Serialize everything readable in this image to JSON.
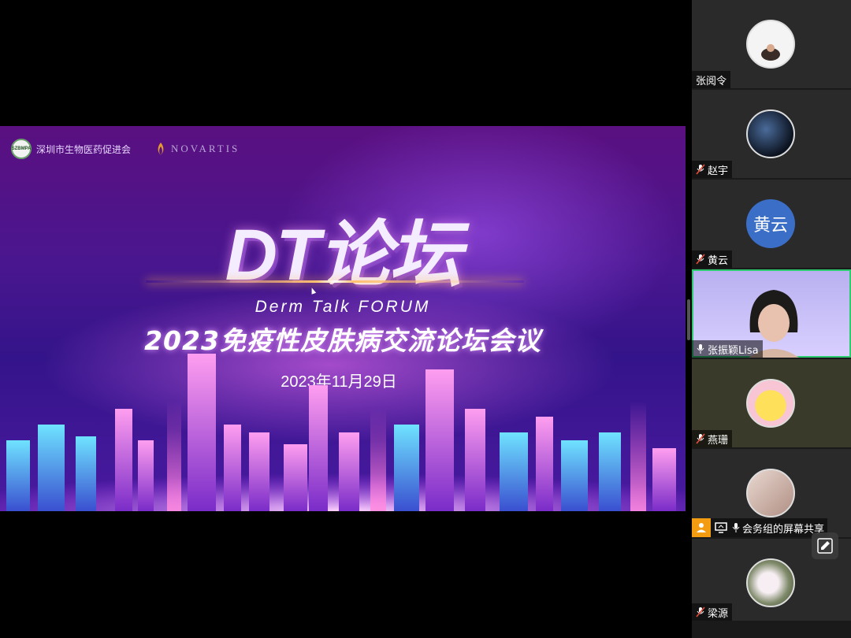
{
  "slide": {
    "org_seal": "SZBMPA",
    "org_name": "深圳市生物医药促进会",
    "sponsor": "NOVARTIS",
    "main_title": "DT论坛",
    "subtitle_en": "Derm Talk FORUM",
    "subtitle_cn": "2023免疫性皮肤病交流论坛会议",
    "date": "2023年11月29日"
  },
  "participants": [
    {
      "name": "张阅令",
      "muted": false,
      "avatar": "photo",
      "active": false
    },
    {
      "name": "赵宇",
      "muted": true,
      "avatar": "photo",
      "active": false
    },
    {
      "name": "黄云",
      "muted": true,
      "avatar_text": "黄云",
      "active": false
    },
    {
      "name": "张振颖Lisa",
      "muted": false,
      "avatar": "video",
      "active": true
    },
    {
      "name": "燕珊",
      "muted": true,
      "avatar": "photo",
      "active": false
    },
    {
      "name": "会务组的屏幕共享",
      "muted": false,
      "avatar": "photo",
      "active": false,
      "sharing": true
    },
    {
      "name": "梁源",
      "muted": true,
      "avatar": "photo",
      "active": false
    }
  ],
  "colors": {
    "active_border": "#2ecc71",
    "share_badge": "#f39c12",
    "avatar_text_bg": "#3b6fc7"
  }
}
